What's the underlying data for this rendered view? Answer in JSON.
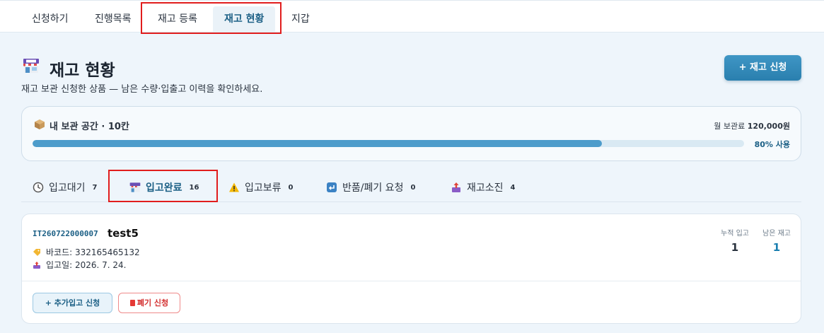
{
  "nav": {
    "tabs": [
      {
        "label": "신청하기"
      },
      {
        "label": "진행목록"
      },
      {
        "label": "재고 등록"
      },
      {
        "label": "재고 현황"
      },
      {
        "label": "지갑"
      }
    ],
    "active_tab": "재고 현황"
  },
  "header": {
    "title": "재고 현황",
    "subtitle": "재고 보관 신청한 상품 — 남은 수량·입출고 이력을 확인하세요.",
    "apply_button": "+ 재고 신청",
    "title_icon": "store-icon"
  },
  "storage": {
    "label": "내 보관 공간 · 10칸",
    "fee_label": "월 보관료",
    "fee_value": "120,000원",
    "usage_text": "80% 사용",
    "usage_fraction": 0.8,
    "icon": "box-icon"
  },
  "status_tabs": [
    {
      "label": "입고대기",
      "count": "7",
      "icon": "clock-icon"
    },
    {
      "label": "입고완료",
      "count": "16",
      "icon": "store-icon"
    },
    {
      "label": "입고보류",
      "count": "0",
      "icon": "warning-icon"
    },
    {
      "label": "반품/폐기 요청",
      "count": "0",
      "icon": "return-icon"
    },
    {
      "label": "재고소진",
      "count": "4",
      "icon": "outbox-icon"
    }
  ],
  "active_status": "입고완료",
  "item": {
    "code": "IT260722000007",
    "name": "test5",
    "barcode": "바코드: 332165465132",
    "received_date": "입고일: 2026. 7. 24.",
    "cumulative_label": "누적 입고",
    "cumulative_value": "1",
    "remaining_label": "남은 재고",
    "remaining_value": "1",
    "add_button": "+ 추가입고 신청",
    "discard_button": "폐기 신청"
  },
  "colors": {
    "accent": "#2a7fae",
    "highlight_box": "#e11d1d",
    "discard": "#d32f2f"
  }
}
